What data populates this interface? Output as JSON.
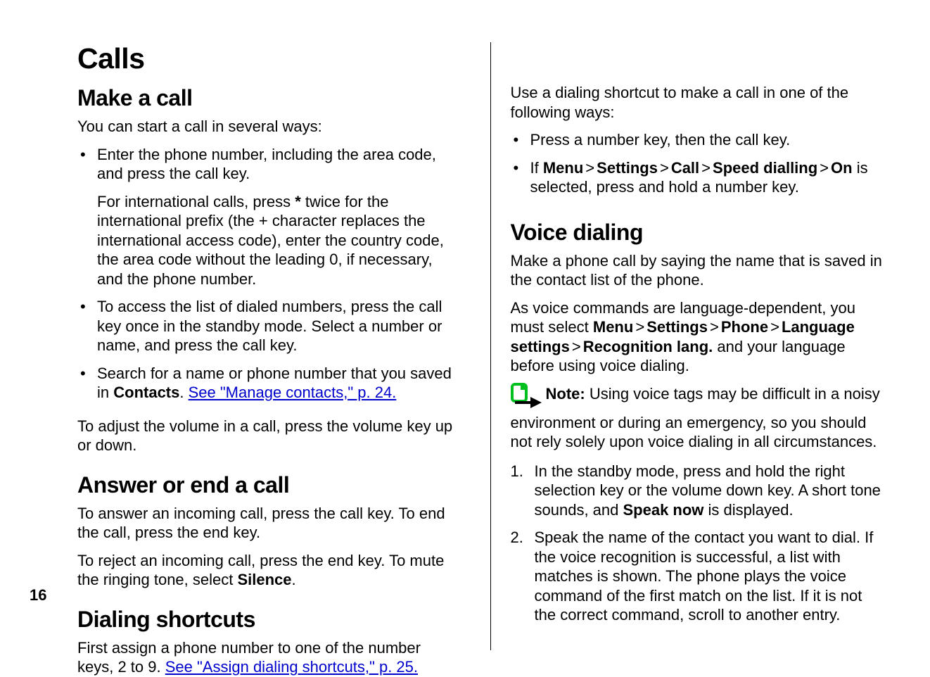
{
  "pageNumber": "16",
  "mainHeading": "Calls",
  "leftColumn": {
    "section1": {
      "heading": "Make a call",
      "intro": "You can start a call in several ways:",
      "bullet1_main": "Enter the phone number, including the area code, and press the call key.",
      "bullet1_sub_a": "For international calls, press ",
      "bullet1_sub_bold": "*",
      "bullet1_sub_b": " twice for the international prefix (the + character replaces the international access code), enter the country code, the area code without the leading 0, if necessary, and the phone number.",
      "bullet2": "To access the list of dialed numbers, press the call key once in the standby mode. Select a number or name, and press the call key.",
      "bullet3_a": "Search for a name or phone number that you saved in ",
      "bullet3_bold": "Contacts",
      "bullet3_b": ". ",
      "bullet3_link": "See \"Manage contacts,\" p. 24.",
      "para2": "To adjust the volume in a call, press the volume key up or down."
    },
    "section2": {
      "heading": "Answer or end a call",
      "para1": "To answer an incoming call, press the call key. To end the call, press the end key.",
      "para2_a": "To reject an incoming call, press the end key. To mute the ringing tone, select ",
      "para2_bold": "Silence",
      "para2_b": "."
    },
    "section3": {
      "heading": "Dialing shortcuts",
      "para1_a": "First assign a phone number to one of the number keys, 2 to 9. ",
      "para1_link": "See \"Assign dialing shortcuts,\" p. 25."
    }
  },
  "rightColumn": {
    "intro": "Use a dialing shortcut to make a call in one of the following ways:",
    "bullet1": "Press a number key, then the call key.",
    "bullet2_a": "If ",
    "bullet2_menu": "Menu",
    "bullet2_settings": "Settings",
    "bullet2_call": "Call",
    "bullet2_speed": "Speed dialling",
    "bullet2_on": "On",
    "bullet2_b": " is selected, press and hold a number key.",
    "sep": ">",
    "section2": {
      "heading": "Voice dialing",
      "para1": "Make a phone call by saying the name that is saved in the contact list of the phone.",
      "para2_a": "As voice commands are language-dependent, you must select ",
      "para2_menu": "Menu",
      "para2_settings": "Settings",
      "para2_phone": "Phone",
      "para2_lang": "Language settings",
      "para2_recog": "Recognition lang.",
      "para2_b": " and your language before using voice dialing.",
      "note_label": "Note:",
      "note_text": "  Using voice tags may be difficult in a noisy environment or during an emergency, so you should not rely solely upon voice dialing in all circumstances.",
      "ol1_a": "In the standby mode, press and hold the right selection key or the volume down key. A short tone sounds, and ",
      "ol1_bold": "Speak now",
      "ol1_b": " is displayed.",
      "ol2": "Speak the name of the contact you want to dial. If the voice recognition is successful, a list with matches is shown. The phone plays the voice command of the first match on the list. If it is not the correct command, scroll to another entry."
    }
  }
}
